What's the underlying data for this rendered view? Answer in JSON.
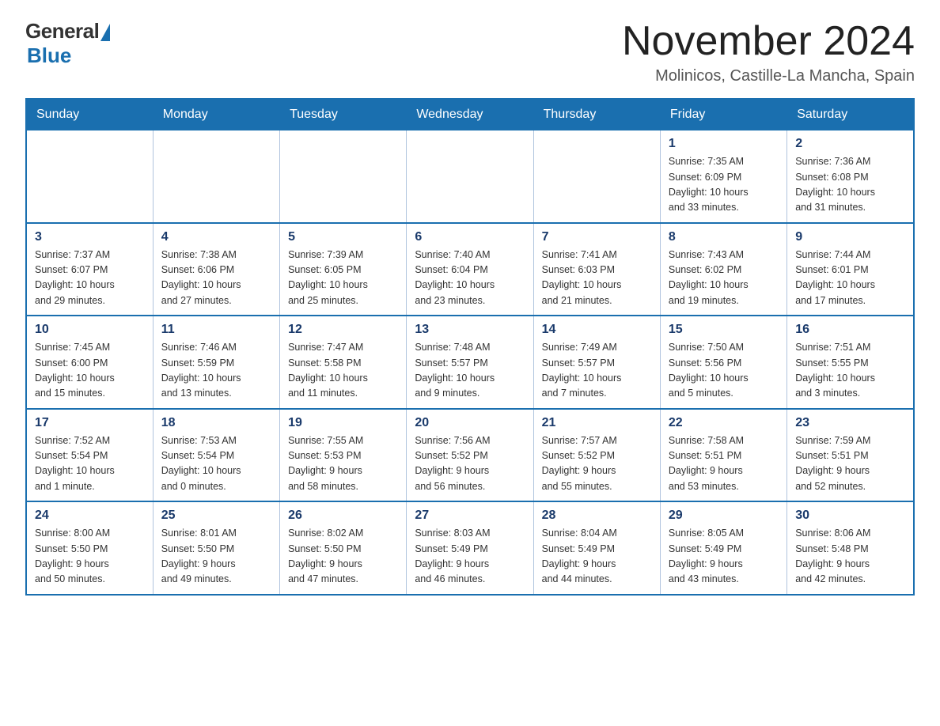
{
  "logo": {
    "general": "General",
    "blue": "Blue"
  },
  "title": "November 2024",
  "subtitle": "Molinicos, Castille-La Mancha, Spain",
  "weekdays": [
    "Sunday",
    "Monday",
    "Tuesday",
    "Wednesday",
    "Thursday",
    "Friday",
    "Saturday"
  ],
  "weeks": [
    [
      {
        "day": "",
        "info": ""
      },
      {
        "day": "",
        "info": ""
      },
      {
        "day": "",
        "info": ""
      },
      {
        "day": "",
        "info": ""
      },
      {
        "day": "",
        "info": ""
      },
      {
        "day": "1",
        "info": "Sunrise: 7:35 AM\nSunset: 6:09 PM\nDaylight: 10 hours\nand 33 minutes."
      },
      {
        "day": "2",
        "info": "Sunrise: 7:36 AM\nSunset: 6:08 PM\nDaylight: 10 hours\nand 31 minutes."
      }
    ],
    [
      {
        "day": "3",
        "info": "Sunrise: 7:37 AM\nSunset: 6:07 PM\nDaylight: 10 hours\nand 29 minutes."
      },
      {
        "day": "4",
        "info": "Sunrise: 7:38 AM\nSunset: 6:06 PM\nDaylight: 10 hours\nand 27 minutes."
      },
      {
        "day": "5",
        "info": "Sunrise: 7:39 AM\nSunset: 6:05 PM\nDaylight: 10 hours\nand 25 minutes."
      },
      {
        "day": "6",
        "info": "Sunrise: 7:40 AM\nSunset: 6:04 PM\nDaylight: 10 hours\nand 23 minutes."
      },
      {
        "day": "7",
        "info": "Sunrise: 7:41 AM\nSunset: 6:03 PM\nDaylight: 10 hours\nand 21 minutes."
      },
      {
        "day": "8",
        "info": "Sunrise: 7:43 AM\nSunset: 6:02 PM\nDaylight: 10 hours\nand 19 minutes."
      },
      {
        "day": "9",
        "info": "Sunrise: 7:44 AM\nSunset: 6:01 PM\nDaylight: 10 hours\nand 17 minutes."
      }
    ],
    [
      {
        "day": "10",
        "info": "Sunrise: 7:45 AM\nSunset: 6:00 PM\nDaylight: 10 hours\nand 15 minutes."
      },
      {
        "day": "11",
        "info": "Sunrise: 7:46 AM\nSunset: 5:59 PM\nDaylight: 10 hours\nand 13 minutes."
      },
      {
        "day": "12",
        "info": "Sunrise: 7:47 AM\nSunset: 5:58 PM\nDaylight: 10 hours\nand 11 minutes."
      },
      {
        "day": "13",
        "info": "Sunrise: 7:48 AM\nSunset: 5:57 PM\nDaylight: 10 hours\nand 9 minutes."
      },
      {
        "day": "14",
        "info": "Sunrise: 7:49 AM\nSunset: 5:57 PM\nDaylight: 10 hours\nand 7 minutes."
      },
      {
        "day": "15",
        "info": "Sunrise: 7:50 AM\nSunset: 5:56 PM\nDaylight: 10 hours\nand 5 minutes."
      },
      {
        "day": "16",
        "info": "Sunrise: 7:51 AM\nSunset: 5:55 PM\nDaylight: 10 hours\nand 3 minutes."
      }
    ],
    [
      {
        "day": "17",
        "info": "Sunrise: 7:52 AM\nSunset: 5:54 PM\nDaylight: 10 hours\nand 1 minute."
      },
      {
        "day": "18",
        "info": "Sunrise: 7:53 AM\nSunset: 5:54 PM\nDaylight: 10 hours\nand 0 minutes."
      },
      {
        "day": "19",
        "info": "Sunrise: 7:55 AM\nSunset: 5:53 PM\nDaylight: 9 hours\nand 58 minutes."
      },
      {
        "day": "20",
        "info": "Sunrise: 7:56 AM\nSunset: 5:52 PM\nDaylight: 9 hours\nand 56 minutes."
      },
      {
        "day": "21",
        "info": "Sunrise: 7:57 AM\nSunset: 5:52 PM\nDaylight: 9 hours\nand 55 minutes."
      },
      {
        "day": "22",
        "info": "Sunrise: 7:58 AM\nSunset: 5:51 PM\nDaylight: 9 hours\nand 53 minutes."
      },
      {
        "day": "23",
        "info": "Sunrise: 7:59 AM\nSunset: 5:51 PM\nDaylight: 9 hours\nand 52 minutes."
      }
    ],
    [
      {
        "day": "24",
        "info": "Sunrise: 8:00 AM\nSunset: 5:50 PM\nDaylight: 9 hours\nand 50 minutes."
      },
      {
        "day": "25",
        "info": "Sunrise: 8:01 AM\nSunset: 5:50 PM\nDaylight: 9 hours\nand 49 minutes."
      },
      {
        "day": "26",
        "info": "Sunrise: 8:02 AM\nSunset: 5:50 PM\nDaylight: 9 hours\nand 47 minutes."
      },
      {
        "day": "27",
        "info": "Sunrise: 8:03 AM\nSunset: 5:49 PM\nDaylight: 9 hours\nand 46 minutes."
      },
      {
        "day": "28",
        "info": "Sunrise: 8:04 AM\nSunset: 5:49 PM\nDaylight: 9 hours\nand 44 minutes."
      },
      {
        "day": "29",
        "info": "Sunrise: 8:05 AM\nSunset: 5:49 PM\nDaylight: 9 hours\nand 43 minutes."
      },
      {
        "day": "30",
        "info": "Sunrise: 8:06 AM\nSunset: 5:48 PM\nDaylight: 9 hours\nand 42 minutes."
      }
    ]
  ]
}
